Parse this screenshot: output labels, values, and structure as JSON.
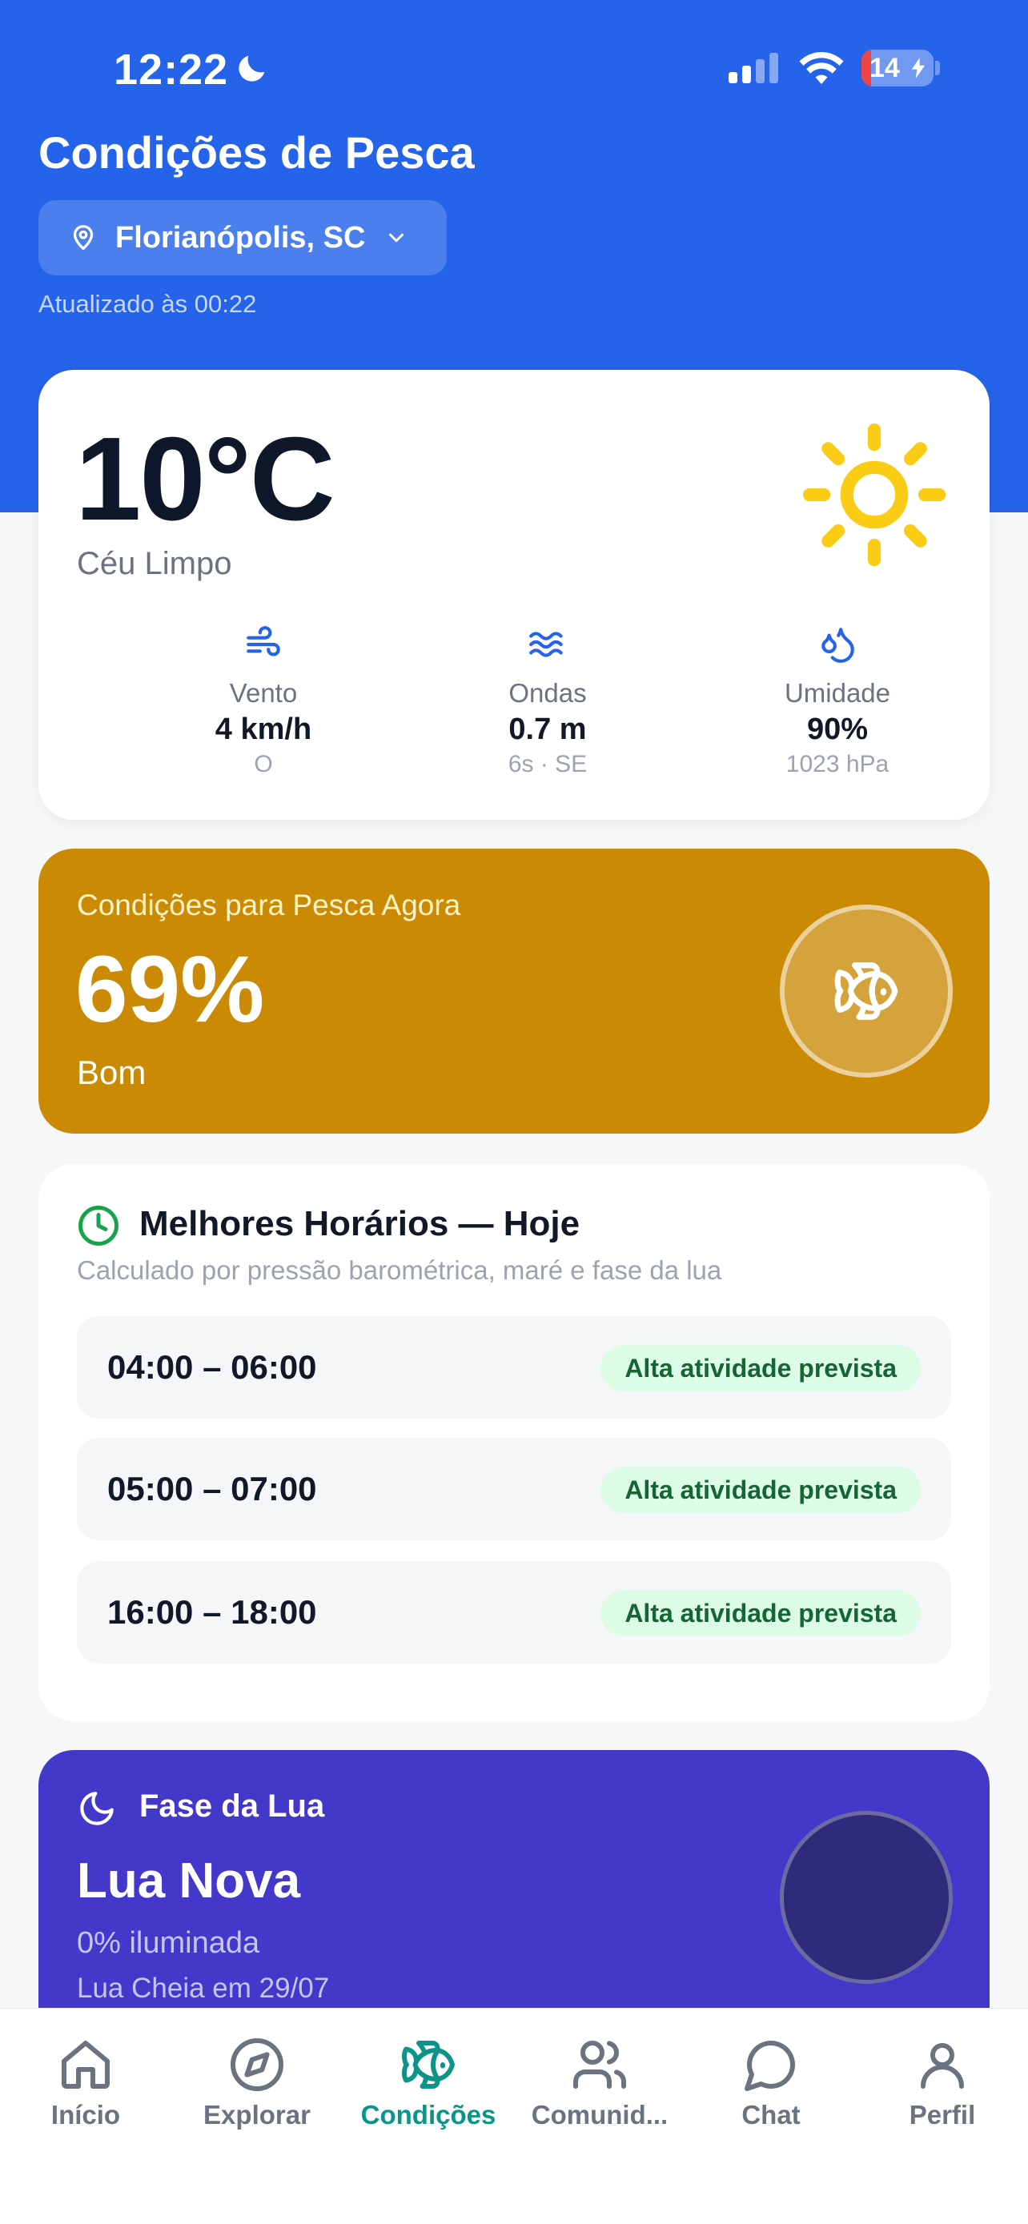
{
  "status_bar": {
    "time": "12:22",
    "battery": "14"
  },
  "header": {
    "title": "Condições de Pesca",
    "location": "Florianópolis, SC",
    "updated": "Atualizado às 00:22"
  },
  "weather": {
    "temperature": "10°C",
    "condition": "Céu Limpo",
    "icon": "sun-icon",
    "metrics": [
      {
        "label": "Vento",
        "value": "4 km/h",
        "sub": "O",
        "icon": "wind-icon"
      },
      {
        "label": "Ondas",
        "value": "0.7 m",
        "sub": "6s · SE",
        "icon": "waves-icon"
      },
      {
        "label": "Umidade",
        "value": "90%",
        "sub": "1023 hPa",
        "icon": "droplets-icon"
      }
    ]
  },
  "fishing_score": {
    "caption": "Condições para Pesca Agora",
    "percent": "69%",
    "rating": "Bom",
    "color": "#ca8a04"
  },
  "best_times": {
    "title": "Melhores Horários — Hoje",
    "description": "Calculado por pressão barométrica, maré e fase da lua",
    "slots": [
      {
        "range": "04:00 – 06:00",
        "badge": "Alta atividade prevista"
      },
      {
        "range": "05:00 – 07:00",
        "badge": "Alta atividade prevista"
      },
      {
        "range": "16:00 – 18:00",
        "badge": "Alta atividade prevista"
      }
    ]
  },
  "moon": {
    "title": "Fase da Lua",
    "phase": "Lua Nova",
    "illumination": "0% iluminada",
    "next_full": "Lua Cheia em 29/07"
  },
  "tabbar": {
    "active": "Condições",
    "accent": "#0d9488",
    "items": [
      {
        "label": "Início",
        "icon": "home-icon"
      },
      {
        "label": "Explorar",
        "icon": "compass-icon"
      },
      {
        "label": "Condições",
        "icon": "fish-icon"
      },
      {
        "label": "Comunid...",
        "icon": "users-icon"
      },
      {
        "label": "Chat",
        "icon": "chat-bubble-icon"
      },
      {
        "label": "Perfil",
        "icon": "user-icon"
      }
    ]
  }
}
